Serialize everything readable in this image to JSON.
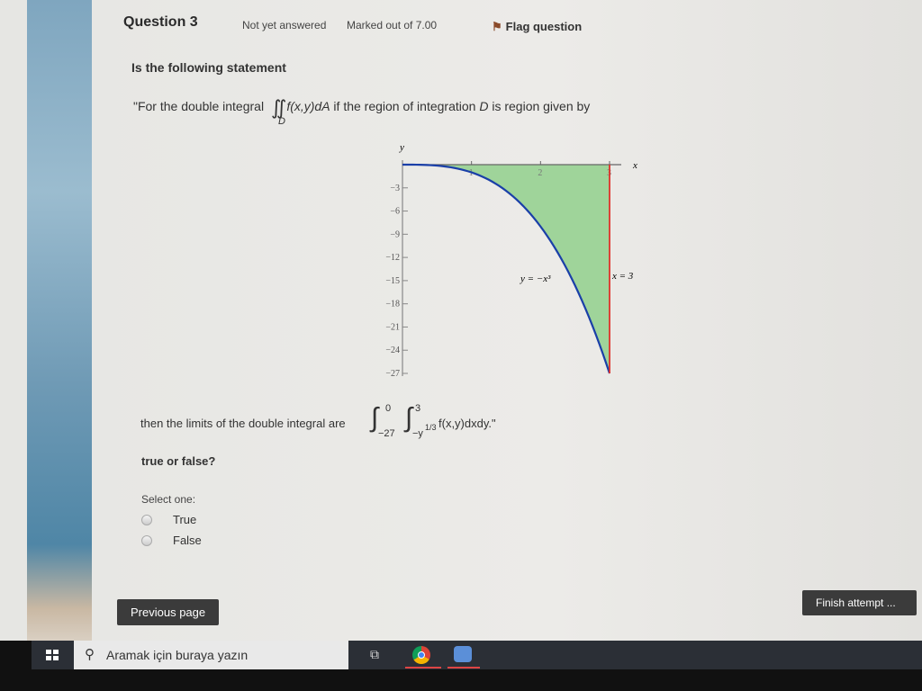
{
  "question": {
    "title": "Question 3",
    "status": "Not yet answered",
    "marks": "Marked out of 7.00",
    "flag_label": "Flag question"
  },
  "stem": {
    "heading": "Is the following statement",
    "line1_prefix": "\"For the double integral",
    "integral1": "∬",
    "integral1_sub": "D",
    "integrand1": "f(x,y)dA",
    "line1_suffix_a": " if the region of integration ",
    "line1_D": "D",
    "line1_suffix_b": " is region given by",
    "line2_prefix": "then the limits of the double integral are",
    "outer_upper": "0",
    "outer_lower": "−27",
    "inner_upper": "3",
    "inner_lower": "−y",
    "inner_lower_exp": "1/3",
    "integrand2": "f(x,y)dxdy.\"",
    "question": "true or false?"
  },
  "chart_data": {
    "type": "area",
    "xlabel": "x",
    "ylabel": "y",
    "xlim": [
      0,
      3
    ],
    "ylim": [
      -27,
      0
    ],
    "x_ticks": [
      "1",
      "2",
      "3"
    ],
    "y_ticks": [
      "−3",
      "−6",
      "−9",
      "−12",
      "−15",
      "−18",
      "−21",
      "−24",
      "−27"
    ],
    "curves": [
      {
        "label": "y = −x³",
        "color": "#1a3fa8"
      },
      {
        "label": "x = 3",
        "color": "#e0302a"
      }
    ],
    "fill_color": "#9fd49a",
    "region": "between y = −x³ and y = 0 for 0 ≤ x ≤ 3"
  },
  "answer": {
    "select_label": "Select one:",
    "options": [
      "True",
      "False"
    ],
    "selected": null
  },
  "nav": {
    "previous": "Previous page",
    "finish": "Finish attempt ..."
  },
  "taskbar": {
    "search_placeholder": "Aramak için buraya yazın"
  }
}
